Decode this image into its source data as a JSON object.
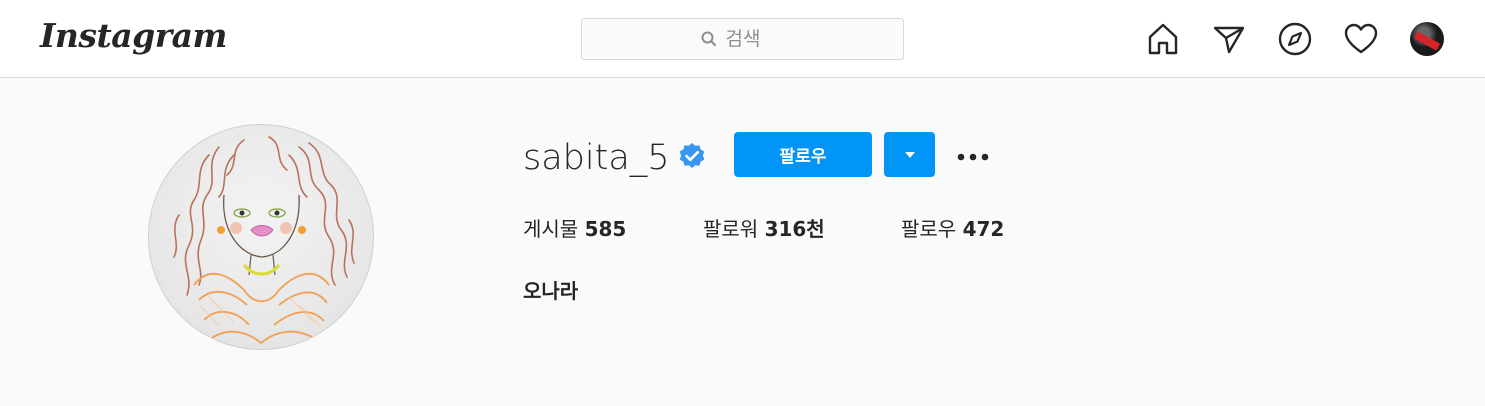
{
  "header": {
    "logo": "Instagram",
    "search": {
      "placeholder": "검색"
    },
    "nav": [
      "home-icon",
      "direct-message-icon",
      "explore-icon",
      "activity-heart-icon",
      "profile-avatar"
    ]
  },
  "profile": {
    "username": "sabita_5",
    "verified": true,
    "follow_label": "팔로우",
    "stats": {
      "posts_label": "게시물",
      "posts_value": "585",
      "followers_label": "팔로워",
      "followers_value": "316천",
      "following_label": "팔로우",
      "following_value": "472"
    },
    "full_name": "오나라"
  },
  "colors": {
    "accent": "#0095f6",
    "verified": "#3897f0",
    "text": "#262626",
    "background": "#fafafa"
  }
}
